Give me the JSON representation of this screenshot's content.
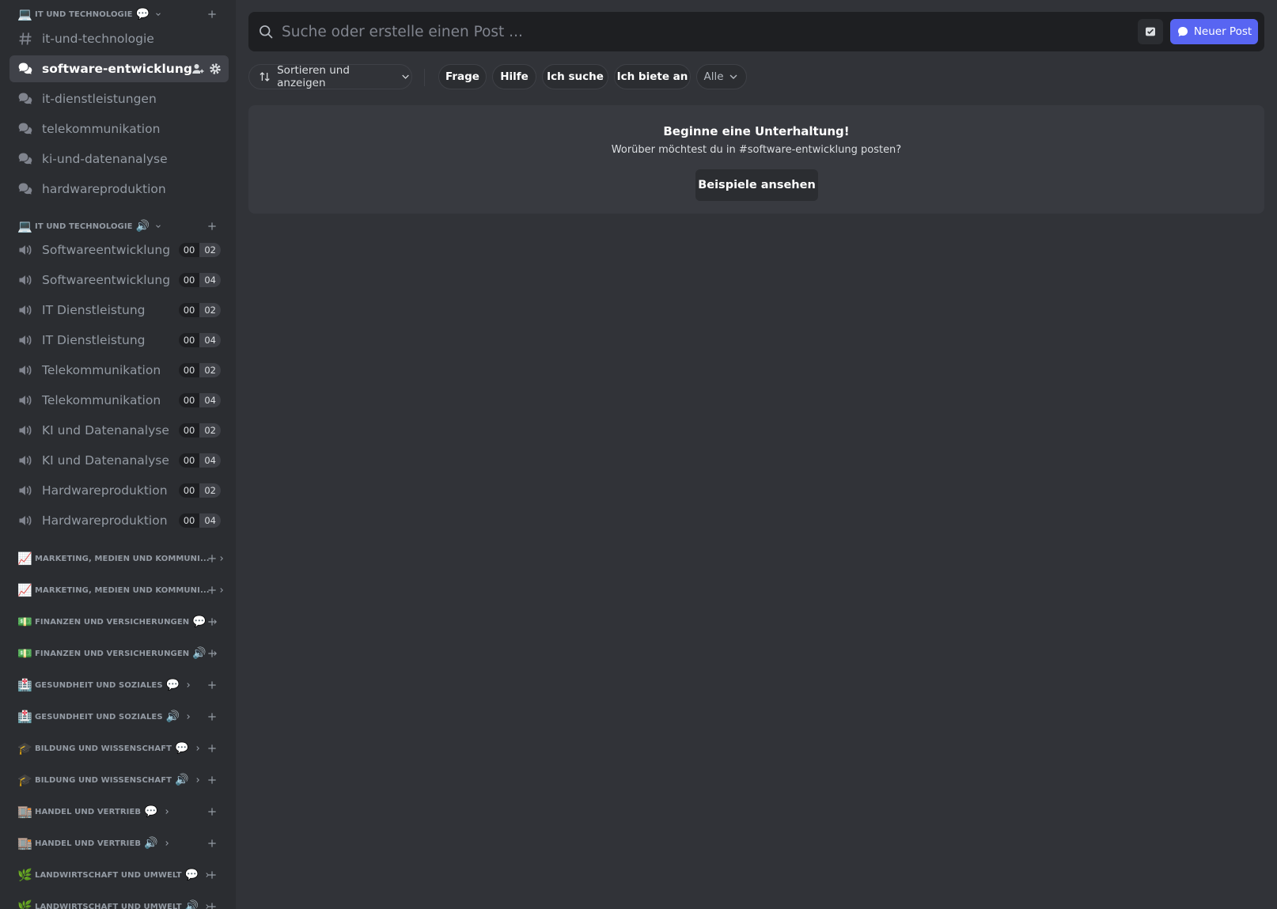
{
  "sidebar": {
    "text_category": {
      "emoji": "💻",
      "name": "IT und Technologie",
      "suffix": "💬"
    },
    "text_channels": [
      {
        "name": "it-und-technologie",
        "icon": "hash-icon",
        "active": false
      },
      {
        "name": "software-entwicklung",
        "icon": "forum-icon",
        "active": true
      },
      {
        "name": "it-dienstleistungen",
        "icon": "forum-icon",
        "active": false
      },
      {
        "name": "telekommunikation",
        "icon": "forum-icon",
        "active": false
      },
      {
        "name": "ki-und-datenanalyse",
        "icon": "forum-icon",
        "active": false
      },
      {
        "name": "hardwareproduktion",
        "icon": "forum-icon",
        "active": false
      }
    ],
    "voice_category": {
      "emoji": "💻",
      "name": "IT und Technologie",
      "suffix": "🔊"
    },
    "voice_channels": [
      {
        "name": "Softwareentwicklung",
        "c1": "00",
        "c2": "02"
      },
      {
        "name": "Softwareentwicklung",
        "c1": "00",
        "c2": "04"
      },
      {
        "name": "IT Dienstleistung",
        "c1": "00",
        "c2": "02"
      },
      {
        "name": "IT Dienstleistung",
        "c1": "00",
        "c2": "04"
      },
      {
        "name": "Telekommunikation",
        "c1": "00",
        "c2": "02"
      },
      {
        "name": "Telekommunikation",
        "c1": "00",
        "c2": "04"
      },
      {
        "name": "KI und Datenanalyse",
        "c1": "00",
        "c2": "02"
      },
      {
        "name": "KI und Datenanalyse",
        "c1": "00",
        "c2": "04"
      },
      {
        "name": "Hardwareproduktion",
        "c1": "00",
        "c2": "02"
      },
      {
        "name": "Hardwareproduktion",
        "c1": "00",
        "c2": "04"
      }
    ],
    "collapsed_categories": [
      {
        "emoji": "📈",
        "name": "Marketing, Medien und Kommuni...",
        "suffix": ""
      },
      {
        "emoji": "📈",
        "name": "Marketing, Medien und Kommuni...",
        "suffix": ""
      },
      {
        "emoji": "💵",
        "name": "Finanzen und Versicherungen",
        "suffix": "💬"
      },
      {
        "emoji": "💵",
        "name": "Finanzen und Versicherungen",
        "suffix": "🔊"
      },
      {
        "emoji": "🏥",
        "name": "Gesundheit und Soziales",
        "suffix": "💬"
      },
      {
        "emoji": "🏥",
        "name": "Gesundheit und Soziales",
        "suffix": "🔊"
      },
      {
        "emoji": "🎓",
        "name": "Bildung und Wissenschaft",
        "suffix": "💬"
      },
      {
        "emoji": "🎓",
        "name": "Bildung und Wissenschaft",
        "suffix": "🔊"
      },
      {
        "emoji": "🏬",
        "name": "Handel und Vertrieb",
        "suffix": "💬"
      },
      {
        "emoji": "🏬",
        "name": "Handel und Vertrieb",
        "suffix": "🔊"
      },
      {
        "emoji": "🌿",
        "name": "Landwirtschaft und Umwelt",
        "suffix": "💬"
      },
      {
        "emoji": "🌿",
        "name": "Landwirtschaft und Umwelt",
        "suffix": "🔊"
      }
    ]
  },
  "search": {
    "placeholder": "Suche oder erstelle einen Post ...",
    "new_post_label": "Neuer Post"
  },
  "filters": {
    "sort_label": "Sortieren und anzeigen",
    "tags": [
      "Frage",
      "Hilfe",
      "Ich suche",
      "Ich biete an"
    ],
    "all_label": "Alle"
  },
  "empty_state": {
    "title": "Beginne eine Unterhaltung!",
    "subtitle": "Worüber möchtest du in #software-entwicklung posten?",
    "button_label": "Beispiele ansehen"
  },
  "colors": {
    "accent": "#5865f2",
    "sidebar_bg": "#2b2d31",
    "main_bg": "#313338"
  }
}
